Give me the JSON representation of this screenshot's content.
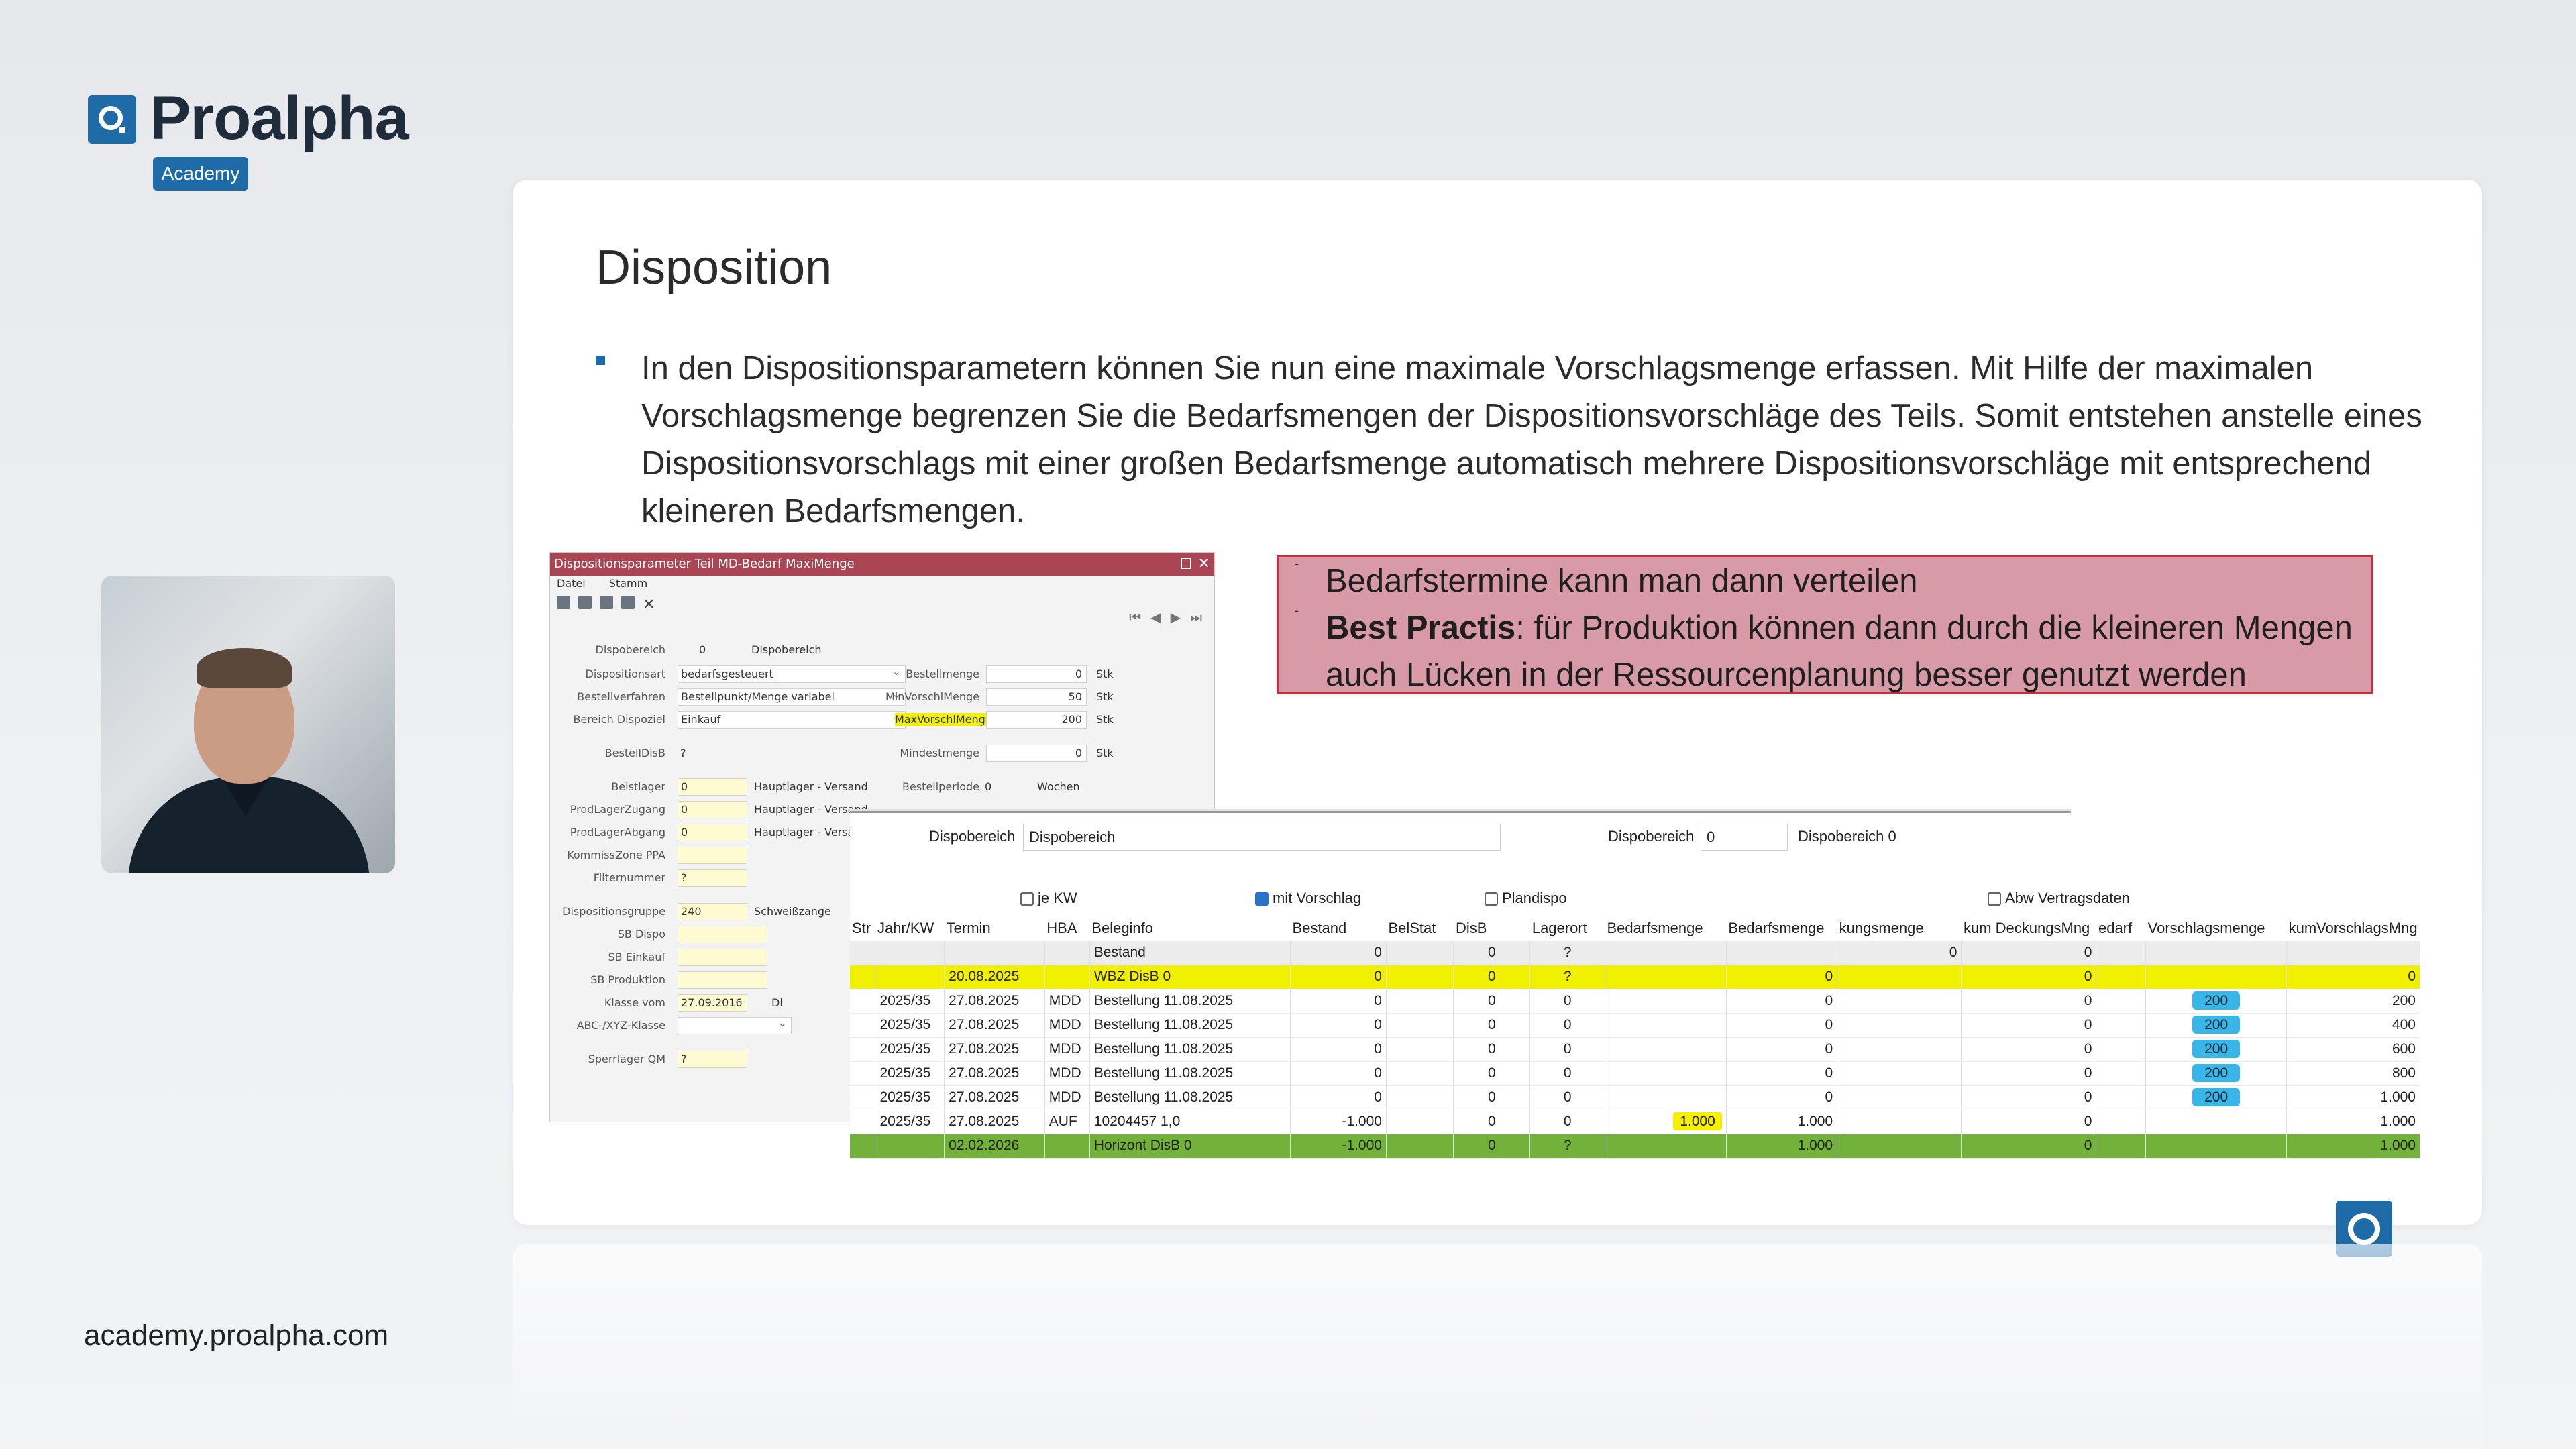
{
  "brand": {
    "name": "Proalpha",
    "sub": "Academy",
    "website": "academy.proalpha.com"
  },
  "slide": {
    "title": "Disposition",
    "paragraph": "In den Dispositionsparametern können Sie nun eine maximale Vorschlagsmenge erfassen. Mit Hilfe der maximalen Vorschlagsmenge begrenzen Sie die Bedarfsmengen der Dispositionsvorschläge des Teils. Somit entstehen anstelle eines Dispositionsvorschlags mit einer großen Bedarfsmenge automatisch mehrere Dispositionsvorschläge mit entsprechend kleineren Bedarfsmengen.",
    "note": {
      "line1": "Bedarfstermine kann man dann verteilen",
      "line2_bold": "Best Practis",
      "line2_rest": ": für Produktion können dann durch die kleineren Mengen",
      "line3": "auch Lücken in der Ressourcenplanung besser genutzt werden"
    }
  },
  "dialog": {
    "title": "Dispositionsparameter  Teil MD-Bedarf MaxiMenge",
    "menu": [
      "Datei",
      "Stamm"
    ],
    "fields": {
      "dispobereich_label": "Dispobereich",
      "dispobereich_val": "0",
      "dispobereich_name": "Dispobereich 0",
      "dispoart_label": "Dispositionsart",
      "dispoart_val": "bedarfsgesteuert",
      "bestellverf_label": "Bestellverfahren",
      "bestellverf_val": "Bestellpunkt/Menge variabel",
      "bereich_label": "Bereich Dispoziel",
      "bereich_val": "Einkauf",
      "bestelldisb_label": "BestellDisB",
      "bestelldisb_val": "?",
      "beistlager_label": "Beistlager",
      "beistlager_val": "0",
      "beistlager_name": "Hauptlager - Versand",
      "prodzugang_label": "ProdLagerZugang",
      "prodzugang_val": "0",
      "prodzugang_name": "Hauptlager - Versand",
      "prodabgang_label": "ProdLagerAbgang",
      "prodabgang_val": "0",
      "prodabgang_name": "Hauptlager - Versand",
      "kommiss_label": "KommissZone PPA",
      "filter_label": "Filternummer",
      "filter_val": "?",
      "dispogruppe_label": "Dispositionsgruppe",
      "dispogruppe_val": "240",
      "dispogruppe_name": "Schweißzange",
      "sbdispo_label": "SB Dispo",
      "sbeinkauf_label": "SB Einkauf",
      "sbprod_label": "SB Produktion",
      "klasse_label": "Klasse vom",
      "klasse_val": "27.09.2016",
      "klasse_extra": "Di",
      "abc_label": "ABC-/XYZ-Klasse",
      "sperr_label": "Sperrlager QM",
      "sperr_val": "?",
      "bestellmenge_label": "Bestellmenge",
      "bestellmenge_val": "0",
      "minvorschl_label": "MinVorschlMenge",
      "minvorschl_val": "50",
      "maxvorschl_label": "MaxVorschlMenge",
      "maxvorschl_val": "200",
      "mindest_label": "Mindestmenge",
      "mindest_val": "0",
      "periode_label": "Bestellperiode",
      "periode_val": "0",
      "periode_unit": "Wochen",
      "unit": "Stk"
    }
  },
  "grid": {
    "dispobereich_label": "Dispobereich",
    "dispobereich_select": "Dispobereich",
    "dispobereich_right_label": "Dispobereich",
    "dispobereich_right_val": "0",
    "dispobereich_right_name": "Dispobereich 0",
    "checks": {
      "jekw": "je KW",
      "mitvorschlag": "mit Vorschlag",
      "plandispo": "Plandispo",
      "abw": "Abw Vertragsdaten"
    },
    "columns": [
      "Str",
      "Jahr/KW",
      "Termin",
      "HBA",
      "Beleginfo",
      "Bestand",
      "BelStat",
      "DisB",
      "Lagerort",
      "Bedarfsmenge",
      "Bedarfsmenge",
      "kungsmenge",
      "kum DeckungsMng",
      "edarf",
      "Vorschlagsmenge",
      "kumVorschlagsMng"
    ],
    "rows": [
      {
        "kind": "gray",
        "c": [
          "",
          "",
          "",
          "",
          "Bestand",
          "0",
          "",
          "0",
          "?",
          "",
          "",
          "0",
          "0",
          "",
          "",
          ""
        ]
      },
      {
        "kind": "yellow",
        "c": [
          "",
          "",
          "20.08.2025",
          "",
          "WBZ DisB 0",
          "0",
          "",
          "0",
          "?",
          "",
          "0",
          "",
          "0",
          "",
          "",
          "0"
        ]
      },
      {
        "kind": "",
        "c": [
          "",
          "2025/35",
          "27.08.2025",
          "MDD",
          "Bestellung 11.08.2025",
          "0",
          "",
          "0",
          "0",
          "",
          "0",
          "",
          "0",
          "",
          "200",
          "200"
        ]
      },
      {
        "kind": "",
        "c": [
          "",
          "2025/35",
          "27.08.2025",
          "MDD",
          "Bestellung 11.08.2025",
          "0",
          "",
          "0",
          "0",
          "",
          "0",
          "",
          "0",
          "",
          "200",
          "400"
        ]
      },
      {
        "kind": "",
        "c": [
          "",
          "2025/35",
          "27.08.2025",
          "MDD",
          "Bestellung 11.08.2025",
          "0",
          "",
          "0",
          "0",
          "",
          "0",
          "",
          "0",
          "",
          "200",
          "600"
        ]
      },
      {
        "kind": "",
        "c": [
          "",
          "2025/35",
          "27.08.2025",
          "MDD",
          "Bestellung 11.08.2025",
          "0",
          "",
          "0",
          "0",
          "",
          "0",
          "",
          "0",
          "",
          "200",
          "800"
        ]
      },
      {
        "kind": "",
        "c": [
          "",
          "2025/35",
          "27.08.2025",
          "MDD",
          "Bestellung 11.08.2025",
          "0",
          "",
          "0",
          "0",
          "",
          "0",
          "",
          "0",
          "",
          "200",
          "1.000"
        ]
      },
      {
        "kind": "",
        "c": [
          "",
          "2025/35",
          "27.08.2025",
          "AUF",
          "10204457  1,0",
          "-1.000",
          "",
          "0",
          "0",
          "1.000",
          "1.000",
          "",
          "0",
          "",
          "",
          "1.000"
        ]
      },
      {
        "kind": "green",
        "c": [
          "",
          "",
          "02.02.2026",
          "",
          "Horizont DisB 0",
          "-1.000",
          "",
          "0",
          "?",
          "",
          "1.000",
          "",
          "0",
          "",
          "",
          "1.000"
        ]
      }
    ]
  },
  "colors": {
    "brand_blue": "#1e6ba8",
    "note_bg": "#d89aa7",
    "note_border": "#c0313f",
    "row_yellow": "#f0f000",
    "row_green": "#73b23a",
    "marker_blue": "#39b6e8"
  }
}
